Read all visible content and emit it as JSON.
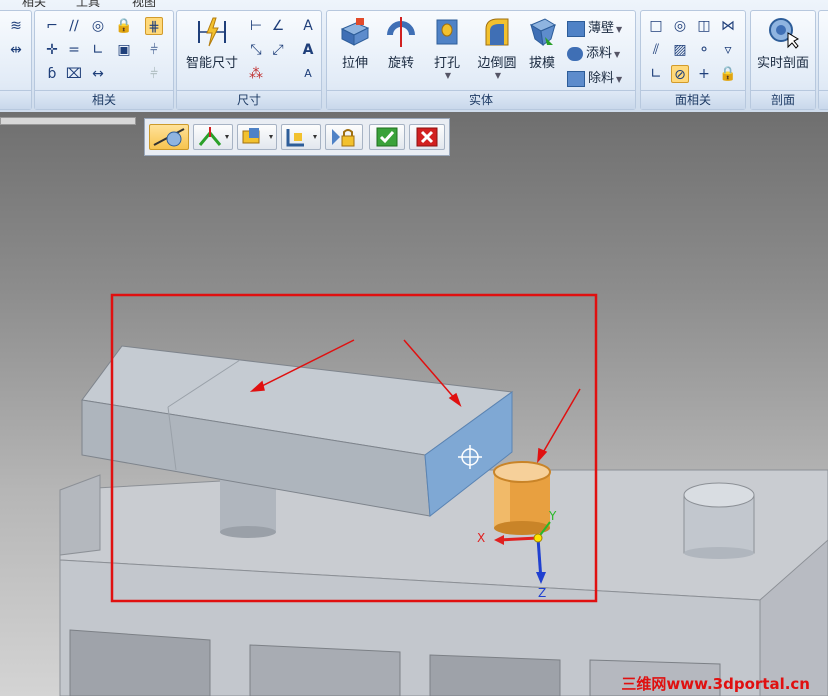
{
  "ribbon": {
    "tabs": [
      "相关",
      "工具",
      "视图"
    ],
    "groups": {
      "relate_label": "相关",
      "dimension_label": "尺寸",
      "solid_label": "实体",
      "face_relate_label": "面相关",
      "section_label": "剖面"
    },
    "buttons": {
      "smart_dimension": "智能尺寸",
      "extrude": "拉伸",
      "revolve": "旋转",
      "hole": "打孔",
      "round": "边倒圆",
      "draft": "拔模",
      "thin_wall": "薄壁",
      "add_material": "添料",
      "remove_material": "除料",
      "live_section": "实时剖面"
    }
  },
  "viewport": {
    "triad": {
      "x": "X",
      "y": "Y",
      "z": "Z"
    },
    "watermark": "三维网www.3dportal.cn"
  },
  "colors": {
    "highlight_box": "#e01010",
    "selected_face": "#7fa8d4",
    "selected_cylinder": "#e8a040",
    "axis_x": "#e02020",
    "axis_y": "#28b828",
    "axis_z": "#2040d0"
  }
}
